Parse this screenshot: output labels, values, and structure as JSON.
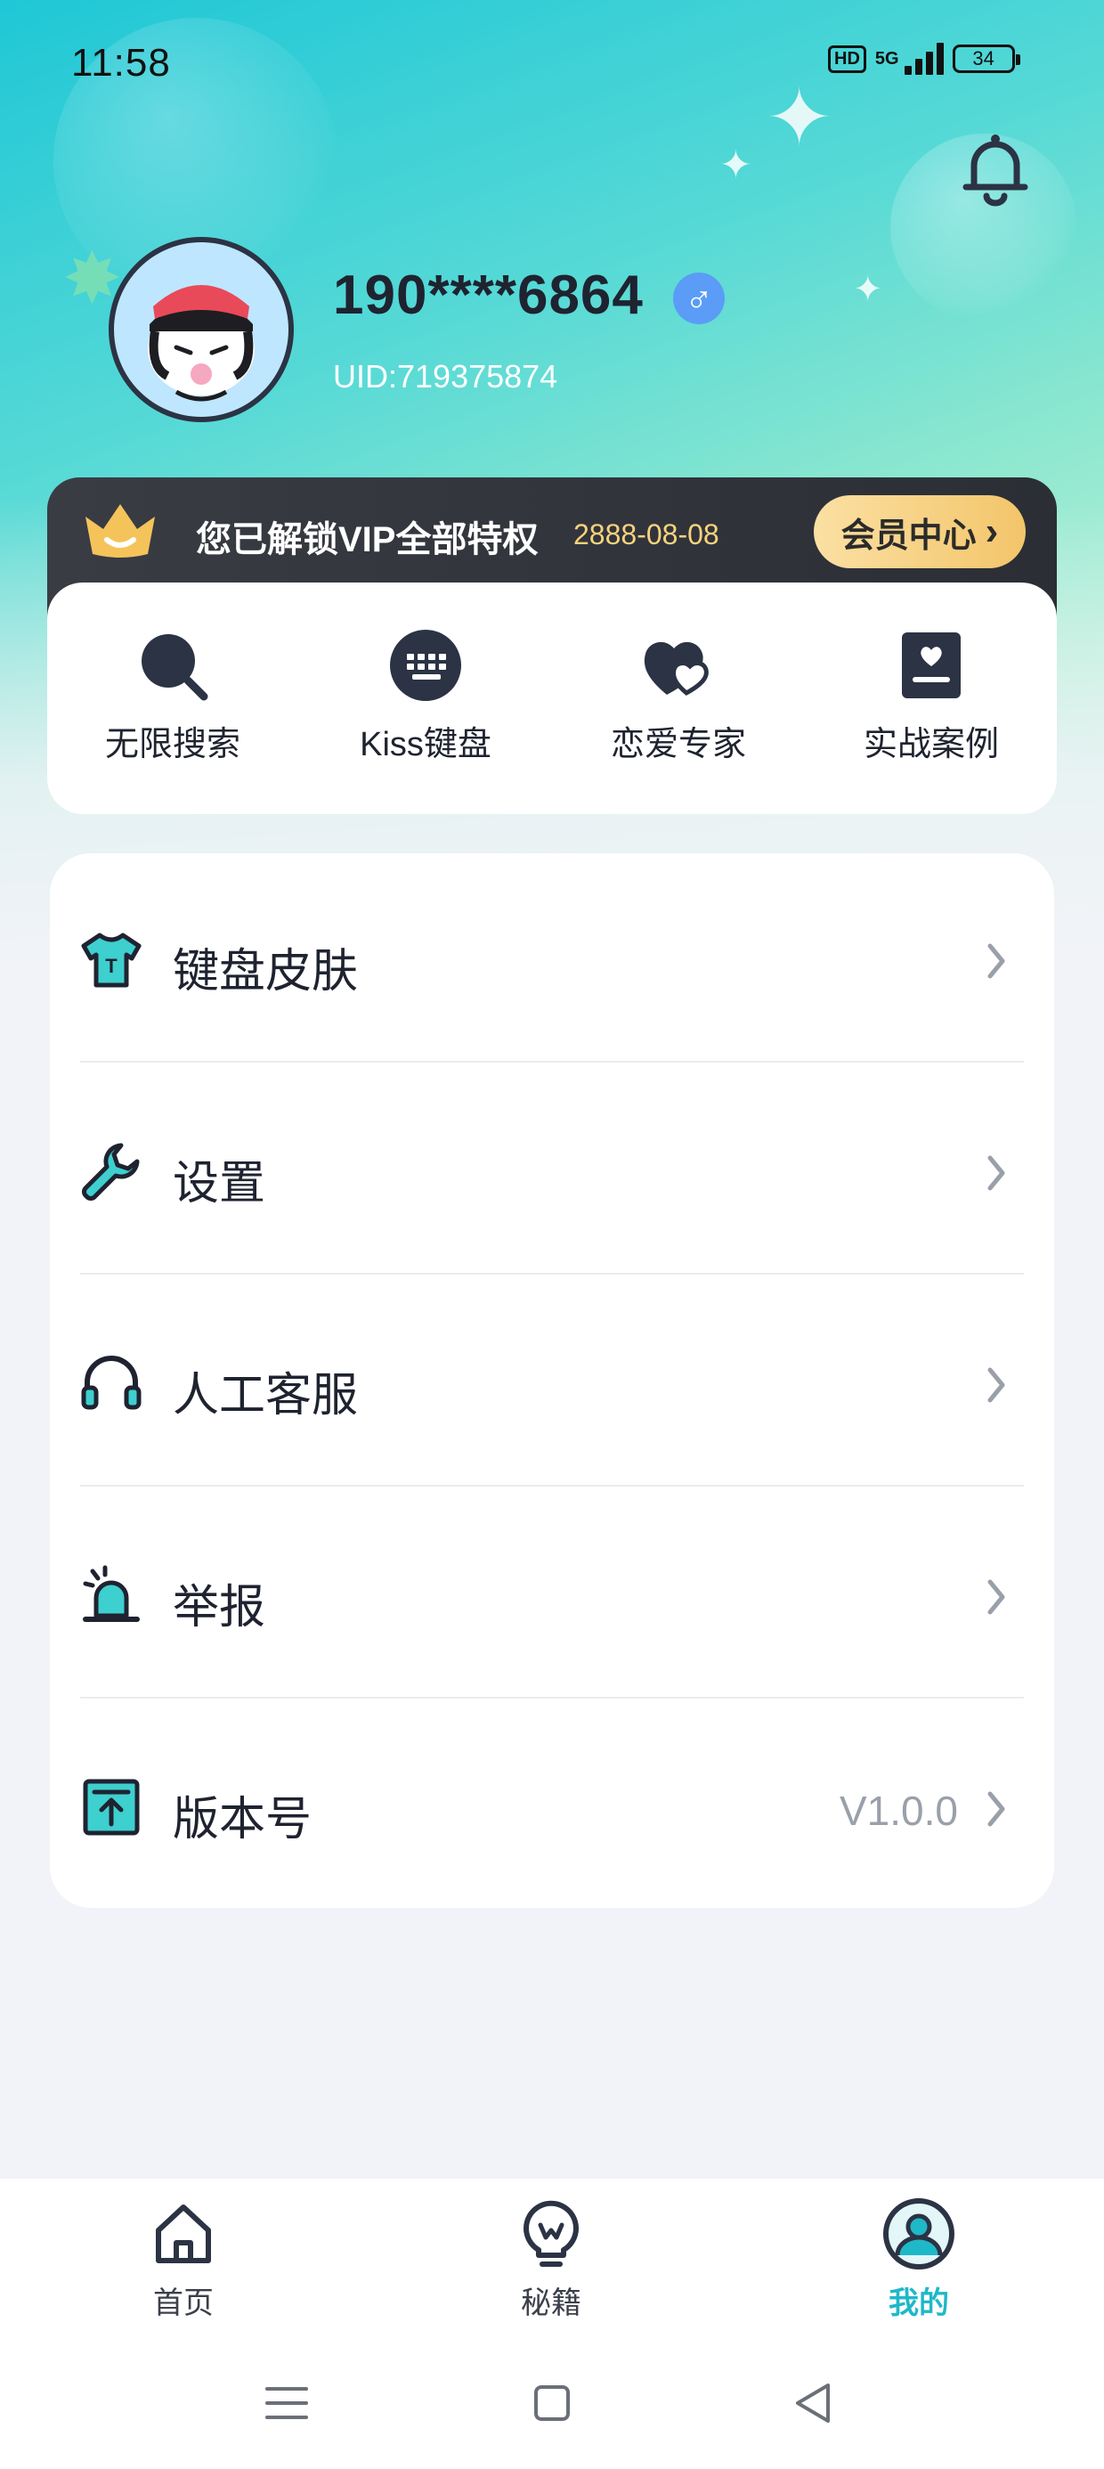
{
  "status_bar": {
    "time": "11:58",
    "hd_label": "HD",
    "network": "5G",
    "battery": "34"
  },
  "profile": {
    "username": "190****6864",
    "gender_symbol": "♂",
    "uid": "UID:719375874"
  },
  "vip": {
    "text": "您已解锁VIP全部特权",
    "expiry": "2888-08-08",
    "member_button": "会员中心",
    "member_button_arrow": "›"
  },
  "features": [
    {
      "label": "无限搜索",
      "icon": "search-icon"
    },
    {
      "label": "Kiss键盘",
      "icon": "keyboard-icon"
    },
    {
      "label": "恋爱专家",
      "icon": "hearts-icon"
    },
    {
      "label": "实战案例",
      "icon": "case-book-icon"
    }
  ],
  "menu": [
    {
      "label": "键盘皮肤",
      "value": "",
      "icon": "tshirt-icon"
    },
    {
      "label": "设置",
      "value": "",
      "icon": "wrench-icon"
    },
    {
      "label": "人工客服",
      "value": "",
      "icon": "headset-icon"
    },
    {
      "label": "举报",
      "value": "",
      "icon": "alarm-icon"
    },
    {
      "label": "版本号",
      "value": "V1.0.0",
      "icon": "version-icon"
    }
  ],
  "bottom_nav": [
    {
      "label": "首页",
      "icon": "home-icon",
      "active": false
    },
    {
      "label": "秘籍",
      "icon": "lightbulb-icon",
      "active": false
    },
    {
      "label": "我的",
      "icon": "profile-icon",
      "active": true
    }
  ],
  "colors": {
    "accent": "#1fb8c8",
    "vip_gold": "#f6d37c",
    "text_dark": "#1f2330"
  }
}
